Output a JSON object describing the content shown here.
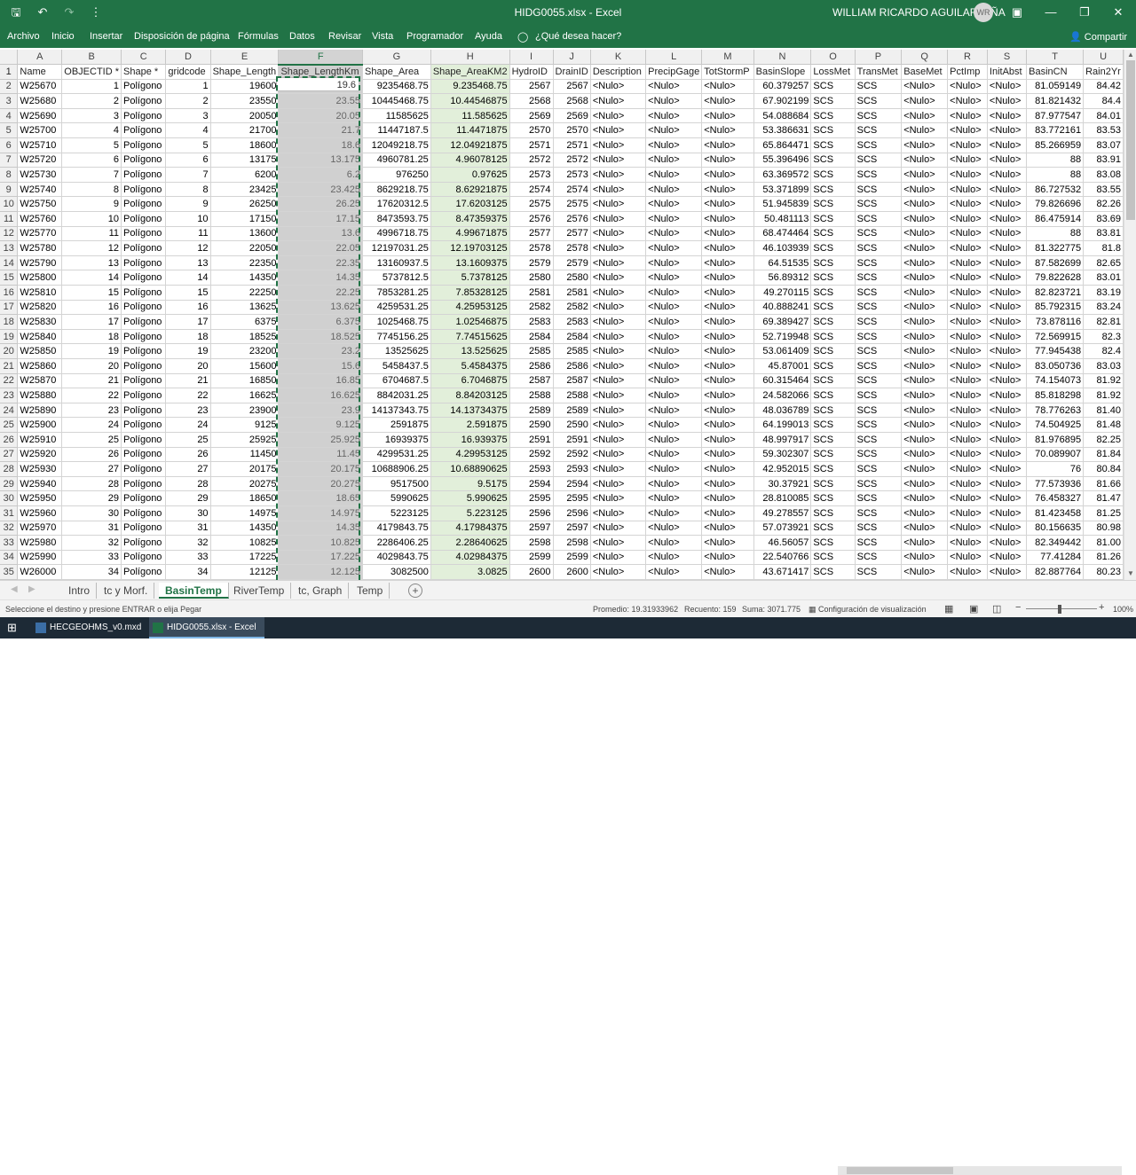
{
  "window": {
    "title": "HIDG0055.xlsx  -  Excel",
    "user": "WILLIAM RICARDO AGUILAR PIÑA",
    "initials": "WR"
  },
  "qat_icons": [
    "save-icon",
    "undo-icon",
    "undo-dropdown-icon",
    "redo-icon",
    "customize-qat-icon"
  ],
  "ribbon": {
    "tabs": [
      "Archivo",
      "Inicio",
      "Insertar",
      "Disposición de página",
      "Fórmulas",
      "Datos",
      "Revisar",
      "Vista",
      "Programador",
      "Ayuda",
      "¿Qué desea hacer?"
    ],
    "share": "Compartir"
  },
  "sheet": {
    "col_letters": [
      "A",
      "B",
      "C",
      "D",
      "E",
      "F",
      "G",
      "H",
      "I",
      "J",
      "K",
      "L",
      "M",
      "N",
      "O",
      "P",
      "Q",
      "R",
      "S",
      "T",
      "U"
    ],
    "header_row": [
      "Name",
      "OBJECTID *",
      "Shape *",
      "gridcode",
      "Shape_Length",
      "Shape_LengthKm",
      "Shape_Area",
      "Shape_AreaKM2",
      "HydroID",
      "DrainID",
      "Description",
      "PrecipGage",
      "TotStormP",
      "BasinSlope",
      "LossMet",
      "TransMet",
      "BaseMet",
      "PctImp",
      "InitAbst",
      "BasinCN",
      "Rain2Yr"
    ],
    "rows": [
      [
        "W25670",
        "1",
        "Polígono",
        "1",
        "19600",
        "19.6",
        "9235468.75",
        "9.235468.75",
        "2567",
        "2567",
        "<Nulo>",
        "<Nulo>",
        "<Nulo>",
        "60.379257",
        "SCS",
        "SCS",
        "<Nulo>",
        "<Nulo>",
        "<Nulo>",
        "81.059149",
        "84.42"
      ],
      [
        "W25680",
        "2",
        "Polígono",
        "2",
        "23550",
        "23.55",
        "10445468.75",
        "10.44546875",
        "2568",
        "2568",
        "<Nulo>",
        "<Nulo>",
        "<Nulo>",
        "67.902199",
        "SCS",
        "SCS",
        "<Nulo>",
        "<Nulo>",
        "<Nulo>",
        "81.821432",
        "84.4"
      ],
      [
        "W25690",
        "3",
        "Polígono",
        "3",
        "20050",
        "20.05",
        "11585625",
        "11.585625",
        "2569",
        "2569",
        "<Nulo>",
        "<Nulo>",
        "<Nulo>",
        "54.088684",
        "SCS",
        "SCS",
        "<Nulo>",
        "<Nulo>",
        "<Nulo>",
        "87.977547",
        "84.01"
      ],
      [
        "W25700",
        "4",
        "Polígono",
        "4",
        "21700",
        "21.7",
        "11447187.5",
        "11.4471875",
        "2570",
        "2570",
        "<Nulo>",
        "<Nulo>",
        "<Nulo>",
        "53.386631",
        "SCS",
        "SCS",
        "<Nulo>",
        "<Nulo>",
        "<Nulo>",
        "83.772161",
        "83.53"
      ],
      [
        "W25710",
        "5",
        "Polígono",
        "5",
        "18600",
        "18.6",
        "12049218.75",
        "12.04921875",
        "2571",
        "2571",
        "<Nulo>",
        "<Nulo>",
        "<Nulo>",
        "65.864471",
        "SCS",
        "SCS",
        "<Nulo>",
        "<Nulo>",
        "<Nulo>",
        "85.266959",
        "83.07"
      ],
      [
        "W25720",
        "6",
        "Polígono",
        "6",
        "13175",
        "13.175",
        "4960781.25",
        "4.96078125",
        "2572",
        "2572",
        "<Nulo>",
        "<Nulo>",
        "<Nulo>",
        "55.396496",
        "SCS",
        "SCS",
        "<Nulo>",
        "<Nulo>",
        "<Nulo>",
        "88",
        "83.91"
      ],
      [
        "W25730",
        "7",
        "Polígono",
        "7",
        "6200",
        "6.2",
        "976250",
        "0.97625",
        "2573",
        "2573",
        "<Nulo>",
        "<Nulo>",
        "<Nulo>",
        "63.369572",
        "SCS",
        "SCS",
        "<Nulo>",
        "<Nulo>",
        "<Nulo>",
        "88",
        "83.08"
      ],
      [
        "W25740",
        "8",
        "Polígono",
        "8",
        "23425",
        "23.425",
        "8629218.75",
        "8.62921875",
        "2574",
        "2574",
        "<Nulo>",
        "<Nulo>",
        "<Nulo>",
        "53.371899",
        "SCS",
        "SCS",
        "<Nulo>",
        "<Nulo>",
        "<Nulo>",
        "86.727532",
        "83.55"
      ],
      [
        "W25750",
        "9",
        "Polígono",
        "9",
        "26250",
        "26.25",
        "17620312.5",
        "17.6203125",
        "2575",
        "2575",
        "<Nulo>",
        "<Nulo>",
        "<Nulo>",
        "51.945839",
        "SCS",
        "SCS",
        "<Nulo>",
        "<Nulo>",
        "<Nulo>",
        "79.826696",
        "82.26"
      ],
      [
        "W25760",
        "10",
        "Polígono",
        "10",
        "17150",
        "17.15",
        "8473593.75",
        "8.47359375",
        "2576",
        "2576",
        "<Nulo>",
        "<Nulo>",
        "<Nulo>",
        "50.481113",
        "SCS",
        "SCS",
        "<Nulo>",
        "<Nulo>",
        "<Nulo>",
        "86.475914",
        "83.69"
      ],
      [
        "W25770",
        "11",
        "Polígono",
        "11",
        "13600",
        "13.6",
        "4996718.75",
        "4.99671875",
        "2577",
        "2577",
        "<Nulo>",
        "<Nulo>",
        "<Nulo>",
        "68.474464",
        "SCS",
        "SCS",
        "<Nulo>",
        "<Nulo>",
        "<Nulo>",
        "88",
        "83.81"
      ],
      [
        "W25780",
        "12",
        "Polígono",
        "12",
        "22050",
        "22.05",
        "12197031.25",
        "12.19703125",
        "2578",
        "2578",
        "<Nulo>",
        "<Nulo>",
        "<Nulo>",
        "46.103939",
        "SCS",
        "SCS",
        "<Nulo>",
        "<Nulo>",
        "<Nulo>",
        "81.322775",
        "81.8"
      ],
      [
        "W25790",
        "13",
        "Polígono",
        "13",
        "22350",
        "22.35",
        "13160937.5",
        "13.1609375",
        "2579",
        "2579",
        "<Nulo>",
        "<Nulo>",
        "<Nulo>",
        "64.51535",
        "SCS",
        "SCS",
        "<Nulo>",
        "<Nulo>",
        "<Nulo>",
        "87.582699",
        "82.65"
      ],
      [
        "W25800",
        "14",
        "Polígono",
        "14",
        "14350",
        "14.35",
        "5737812.5",
        "5.7378125",
        "2580",
        "2580",
        "<Nulo>",
        "<Nulo>",
        "<Nulo>",
        "56.89312",
        "SCS",
        "SCS",
        "<Nulo>",
        "<Nulo>",
        "<Nulo>",
        "79.822628",
        "83.01"
      ],
      [
        "W25810",
        "15",
        "Polígono",
        "15",
        "22250",
        "22.25",
        "7853281.25",
        "7.85328125",
        "2581",
        "2581",
        "<Nulo>",
        "<Nulo>",
        "<Nulo>",
        "49.270115",
        "SCS",
        "SCS",
        "<Nulo>",
        "<Nulo>",
        "<Nulo>",
        "82.823721",
        "83.19"
      ],
      [
        "W25820",
        "16",
        "Polígono",
        "16",
        "13625",
        "13.625",
        "4259531.25",
        "4.25953125",
        "2582",
        "2582",
        "<Nulo>",
        "<Nulo>",
        "<Nulo>",
        "40.888241",
        "SCS",
        "SCS",
        "<Nulo>",
        "<Nulo>",
        "<Nulo>",
        "85.792315",
        "83.24"
      ],
      [
        "W25830",
        "17",
        "Polígono",
        "17",
        "6375",
        "6.375",
        "1025468.75",
        "1.02546875",
        "2583",
        "2583",
        "<Nulo>",
        "<Nulo>",
        "<Nulo>",
        "69.389427",
        "SCS",
        "SCS",
        "<Nulo>",
        "<Nulo>",
        "<Nulo>",
        "73.878116",
        "82.81"
      ],
      [
        "W25840",
        "18",
        "Polígono",
        "18",
        "18525",
        "18.525",
        "7745156.25",
        "7.74515625",
        "2584",
        "2584",
        "<Nulo>",
        "<Nulo>",
        "<Nulo>",
        "52.719948",
        "SCS",
        "SCS",
        "<Nulo>",
        "<Nulo>",
        "<Nulo>",
        "72.569915",
        "82.3"
      ],
      [
        "W25850",
        "19",
        "Polígono",
        "19",
        "23200",
        "23.2",
        "13525625",
        "13.525625",
        "2585",
        "2585",
        "<Nulo>",
        "<Nulo>",
        "<Nulo>",
        "53.061409",
        "SCS",
        "SCS",
        "<Nulo>",
        "<Nulo>",
        "<Nulo>",
        "77.945438",
        "82.4"
      ],
      [
        "W25860",
        "20",
        "Polígono",
        "20",
        "15600",
        "15.6",
        "5458437.5",
        "5.4584375",
        "2586",
        "2586",
        "<Nulo>",
        "<Nulo>",
        "<Nulo>",
        "45.87001",
        "SCS",
        "SCS",
        "<Nulo>",
        "<Nulo>",
        "<Nulo>",
        "83.050736",
        "83.03"
      ],
      [
        "W25870",
        "21",
        "Polígono",
        "21",
        "16850",
        "16.85",
        "6704687.5",
        "6.7046875",
        "2587",
        "2587",
        "<Nulo>",
        "<Nulo>",
        "<Nulo>",
        "60.315464",
        "SCS",
        "SCS",
        "<Nulo>",
        "<Nulo>",
        "<Nulo>",
        "74.154073",
        "81.92"
      ],
      [
        "W25880",
        "22",
        "Polígono",
        "22",
        "16625",
        "16.625",
        "8842031.25",
        "8.84203125",
        "2588",
        "2588",
        "<Nulo>",
        "<Nulo>",
        "<Nulo>",
        "24.582066",
        "SCS",
        "SCS",
        "<Nulo>",
        "<Nulo>",
        "<Nulo>",
        "85.818298",
        "81.92"
      ],
      [
        "W25890",
        "23",
        "Polígono",
        "23",
        "23900",
        "23.9",
        "14137343.75",
        "14.13734375",
        "2589",
        "2589",
        "<Nulo>",
        "<Nulo>",
        "<Nulo>",
        "48.036789",
        "SCS",
        "SCS",
        "<Nulo>",
        "<Nulo>",
        "<Nulo>",
        "78.776263",
        "81.40"
      ],
      [
        "W25900",
        "24",
        "Polígono",
        "24",
        "9125",
        "9.125",
        "2591875",
        "2.591875",
        "2590",
        "2590",
        "<Nulo>",
        "<Nulo>",
        "<Nulo>",
        "64.199013",
        "SCS",
        "SCS",
        "<Nulo>",
        "<Nulo>",
        "<Nulo>",
        "74.504925",
        "81.48"
      ],
      [
        "W25910",
        "25",
        "Polígono",
        "25",
        "25925",
        "25.925",
        "16939375",
        "16.939375",
        "2591",
        "2591",
        "<Nulo>",
        "<Nulo>",
        "<Nulo>",
        "48.997917",
        "SCS",
        "SCS",
        "<Nulo>",
        "<Nulo>",
        "<Nulo>",
        "81.976895",
        "82.25"
      ],
      [
        "W25920",
        "26",
        "Polígono",
        "26",
        "11450",
        "11.45",
        "4299531.25",
        "4.29953125",
        "2592",
        "2592",
        "<Nulo>",
        "<Nulo>",
        "<Nulo>",
        "59.302307",
        "SCS",
        "SCS",
        "<Nulo>",
        "<Nulo>",
        "<Nulo>",
        "70.089907",
        "81.84"
      ],
      [
        "W25930",
        "27",
        "Polígono",
        "27",
        "20175",
        "20.175",
        "10688906.25",
        "10.68890625",
        "2593",
        "2593",
        "<Nulo>",
        "<Nulo>",
        "<Nulo>",
        "42.952015",
        "SCS",
        "SCS",
        "<Nulo>",
        "<Nulo>",
        "<Nulo>",
        "76",
        "80.84"
      ],
      [
        "W25940",
        "28",
        "Polígono",
        "28",
        "20275",
        "20.275",
        "9517500",
        "9.5175",
        "2594",
        "2594",
        "<Nulo>",
        "<Nulo>",
        "<Nulo>",
        "30.37921",
        "SCS",
        "SCS",
        "<Nulo>",
        "<Nulo>",
        "<Nulo>",
        "77.573936",
        "81.66"
      ],
      [
        "W25950",
        "29",
        "Polígono",
        "29",
        "18650",
        "18.65",
        "5990625",
        "5.990625",
        "2595",
        "2595",
        "<Nulo>",
        "<Nulo>",
        "<Nulo>",
        "28.810085",
        "SCS",
        "SCS",
        "<Nulo>",
        "<Nulo>",
        "<Nulo>",
        "76.458327",
        "81.47"
      ],
      [
        "W25960",
        "30",
        "Polígono",
        "30",
        "14975",
        "14.975",
        "5223125",
        "5.223125",
        "2596",
        "2596",
        "<Nulo>",
        "<Nulo>",
        "<Nulo>",
        "49.278557",
        "SCS",
        "SCS",
        "<Nulo>",
        "<Nulo>",
        "<Nulo>",
        "81.423458",
        "81.25"
      ],
      [
        "W25970",
        "31",
        "Polígono",
        "31",
        "14350",
        "14.35",
        "4179843.75",
        "4.17984375",
        "2597",
        "2597",
        "<Nulo>",
        "<Nulo>",
        "<Nulo>",
        "57.073921",
        "SCS",
        "SCS",
        "<Nulo>",
        "<Nulo>",
        "<Nulo>",
        "80.156635",
        "80.98"
      ],
      [
        "W25980",
        "32",
        "Polígono",
        "32",
        "10825",
        "10.825",
        "2286406.25",
        "2.28640625",
        "2598",
        "2598",
        "<Nulo>",
        "<Nulo>",
        "<Nulo>",
        "46.56057",
        "SCS",
        "SCS",
        "<Nulo>",
        "<Nulo>",
        "<Nulo>",
        "82.349442",
        "81.00"
      ],
      [
        "W25990",
        "33",
        "Polígono",
        "33",
        "17225",
        "17.225",
        "4029843.75",
        "4.02984375",
        "2599",
        "2599",
        "<Nulo>",
        "<Nulo>",
        "<Nulo>",
        "22.540766",
        "SCS",
        "SCS",
        "<Nulo>",
        "<Nulo>",
        "<Nulo>",
        "77.41284",
        "81.26"
      ],
      [
        "W26000",
        "34",
        "Polígono",
        "34",
        "12125",
        "12.125",
        "3082500",
        "3.0825",
        "2600",
        "2600",
        "<Nulo>",
        "<Nulo>",
        "<Nulo>",
        "43.671417",
        "SCS",
        "SCS",
        "<Nulo>",
        "<Nulo>",
        "<Nulo>",
        "82.887764",
        "80.23"
      ]
    ]
  },
  "sheet_tabs": [
    "Intro",
    "tc y Morf.",
    "BasinTemp",
    "RiverTemp",
    "tc, Graph",
    "Temp"
  ],
  "active_tab": "BasinTemp",
  "status": {
    "message": "Seleccione el destino y presione ENTRAR o elija Pegar",
    "average": "Promedio: 19.31933962",
    "count": "Recuento: 159",
    "sum": "Suma: 3071.775",
    "display_settings": "Configuración de visualización",
    "zoom": "100%"
  },
  "taskbar": {
    "items": [
      "HECGEOHMS_v0.mxd ...",
      "HIDG0055.xlsx - Excel"
    ]
  },
  "colors": {
    "excel_green": "#217346",
    "selection_gray": "#d0d0d0",
    "highlight_green": "#e2efda"
  }
}
